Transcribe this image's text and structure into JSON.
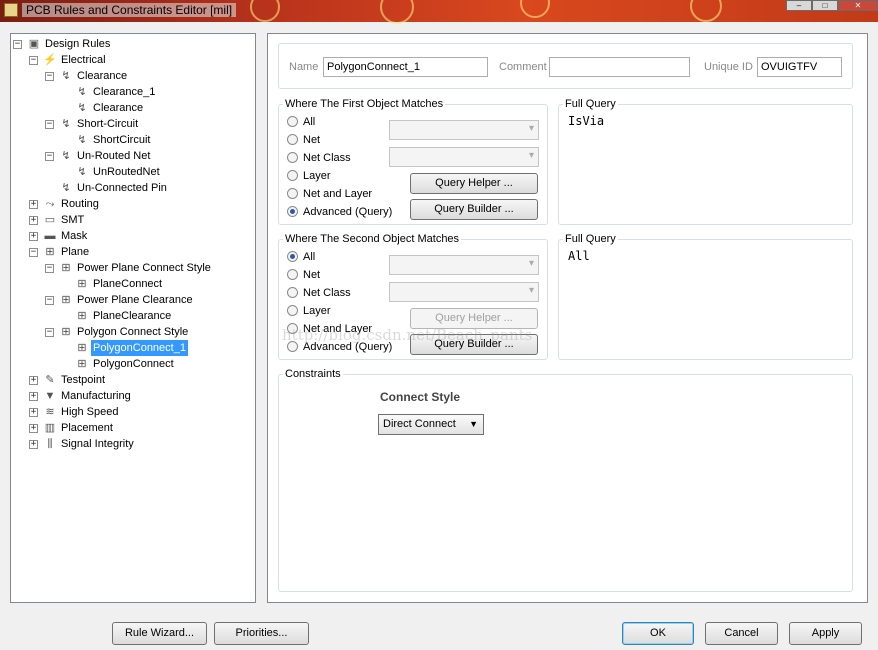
{
  "window": {
    "title": "PCB Rules and Constraints Editor [mil]"
  },
  "tree": [
    {
      "label": "Design Rules",
      "level": 0,
      "toggle": "−",
      "icon": "rules-root-icon",
      "glyph": "▣"
    },
    {
      "label": "Electrical",
      "level": 1,
      "toggle": "−",
      "icon": "electrical-icon",
      "glyph": "⚡"
    },
    {
      "label": "Clearance",
      "level": 2,
      "toggle": "−",
      "icon": "clearance-icon",
      "glyph": "↯"
    },
    {
      "label": "Clearance_1",
      "level": 3,
      "toggle": "",
      "icon": "clearance-rule-icon",
      "glyph": "↯"
    },
    {
      "label": "Clearance",
      "level": 3,
      "toggle": "",
      "icon": "clearance-rule-icon",
      "glyph": "↯"
    },
    {
      "label": "Short-Circuit",
      "level": 2,
      "toggle": "−",
      "icon": "short-circuit-icon",
      "glyph": "↯"
    },
    {
      "label": "ShortCircuit",
      "level": 3,
      "toggle": "",
      "icon": "short-circuit-rule-icon",
      "glyph": "↯"
    },
    {
      "label": "Un-Routed Net",
      "level": 2,
      "toggle": "−",
      "icon": "unrouted-net-icon",
      "glyph": "↯"
    },
    {
      "label": "UnRoutedNet",
      "level": 3,
      "toggle": "",
      "icon": "unrouted-net-rule-icon",
      "glyph": "↯"
    },
    {
      "label": "Un-Connected Pin",
      "level": 2,
      "toggle": "",
      "icon": "unconnected-pin-icon",
      "glyph": "↯"
    },
    {
      "label": "Routing",
      "level": 1,
      "toggle": "+",
      "icon": "routing-icon",
      "glyph": "⤳"
    },
    {
      "label": "SMT",
      "level": 1,
      "toggle": "+",
      "icon": "smt-icon",
      "glyph": "▭"
    },
    {
      "label": "Mask",
      "level": 1,
      "toggle": "+",
      "icon": "mask-icon",
      "glyph": "▬"
    },
    {
      "label": "Plane",
      "level": 1,
      "toggle": "−",
      "icon": "plane-icon",
      "glyph": "⊞"
    },
    {
      "label": "Power Plane Connect Style",
      "level": 2,
      "toggle": "−",
      "icon": "plane-connect-style-icon",
      "glyph": "⊞"
    },
    {
      "label": "PlaneConnect",
      "level": 3,
      "toggle": "",
      "icon": "plane-connect-rule-icon",
      "glyph": "⊞"
    },
    {
      "label": "Power Plane Clearance",
      "level": 2,
      "toggle": "−",
      "icon": "plane-clearance-icon",
      "glyph": "⊞"
    },
    {
      "label": "PlaneClearance",
      "level": 3,
      "toggle": "",
      "icon": "plane-clearance-rule-icon",
      "glyph": "⊞"
    },
    {
      "label": "Polygon Connect Style",
      "level": 2,
      "toggle": "−",
      "icon": "polygon-connect-style-icon",
      "glyph": "⊞"
    },
    {
      "label": "PolygonConnect_1",
      "level": 3,
      "toggle": "",
      "icon": "polygon-connect-rule-icon",
      "glyph": "⊞",
      "selected": true
    },
    {
      "label": "PolygonConnect",
      "level": 3,
      "toggle": "",
      "icon": "polygon-connect-rule-icon",
      "glyph": "⊞"
    },
    {
      "label": "Testpoint",
      "level": 1,
      "toggle": "+",
      "icon": "testpoint-icon",
      "glyph": "✎"
    },
    {
      "label": "Manufacturing",
      "level": 1,
      "toggle": "+",
      "icon": "manufacturing-icon",
      "glyph": "▼"
    },
    {
      "label": "High Speed",
      "level": 1,
      "toggle": "+",
      "icon": "high-speed-icon",
      "glyph": "≋"
    },
    {
      "label": "Placement",
      "level": 1,
      "toggle": "+",
      "icon": "placement-icon",
      "glyph": "▥"
    },
    {
      "label": "Signal Integrity",
      "level": 1,
      "toggle": "+",
      "icon": "signal-integrity-icon",
      "glyph": "⫼"
    }
  ],
  "header": {
    "name_label": "Name",
    "name_value": "PolygonConnect_1",
    "comment_label": "Comment",
    "comment_value": "",
    "uid_label": "Unique ID",
    "uid_value": "OVUIGTFV"
  },
  "first_match": {
    "title": "Where The First Object Matches",
    "options": [
      "All",
      "Net",
      "Net Class",
      "Layer",
      "Net and Layer",
      "Advanced (Query)"
    ],
    "selected": 5,
    "helper_label": "Query Helper ...",
    "builder_label": "Query Builder ...",
    "query_title": "Full Query",
    "query": "IsVia"
  },
  "second_match": {
    "title": "Where The Second Object Matches",
    "options": [
      "All",
      "Net",
      "Net Class",
      "Layer",
      "Net and Layer",
      "Advanced (Query)"
    ],
    "selected": 0,
    "helper_label": "Query Helper ...",
    "builder_label": "Query Builder ...",
    "query_title": "Full Query",
    "query": "All"
  },
  "watermark": "http://blog.csdn.net/Beach_pants",
  "constraints": {
    "title": "Constraints",
    "connect_style_label": "Connect Style",
    "connect_style_value": "Direct Connect"
  },
  "footer": {
    "rule_wizard": "Rule Wizard...",
    "priorities": "Priorities...",
    "ok": "OK",
    "cancel": "Cancel",
    "apply": "Apply"
  }
}
